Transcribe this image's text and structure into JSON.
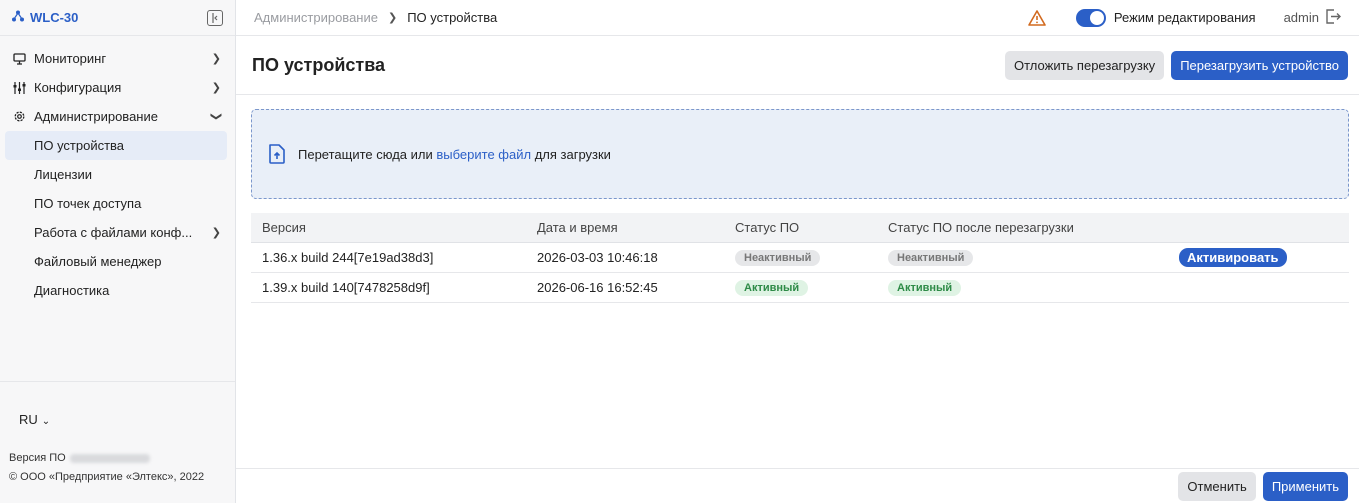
{
  "app": {
    "title": "WLC-30"
  },
  "sidebar": {
    "items": [
      {
        "label": "Мониторинг"
      },
      {
        "label": "Конфигурация"
      },
      {
        "label": "Администрирование"
      }
    ],
    "subitems": [
      {
        "label": "ПО устройства"
      },
      {
        "label": "Лицензии"
      },
      {
        "label": "ПО точек доступа"
      },
      {
        "label": "Работа с файлами конф..."
      },
      {
        "label": "Файловый менеджер"
      },
      {
        "label": "Диагностика"
      }
    ],
    "language": "RU",
    "version_label": "Версия ПО",
    "copyright": "© ООО «Предприятие «Элтекс», 2022"
  },
  "topbar": {
    "breadcrumb_parent": "Администрирование",
    "breadcrumb_current": "ПО устройства",
    "edit_mode_label": "Режим редактирования",
    "username": "admin"
  },
  "page": {
    "title": "ПО устройства",
    "postpone_button": "Отложить перезагрузку",
    "reboot_button": "Перезагрузить устройство"
  },
  "dropzone": {
    "text_before": "Перетащите сюда или ",
    "link": "выберите файл",
    "text_after": " для загрузки"
  },
  "table": {
    "headers": [
      "Версия",
      "Дата и время",
      "Статус ПО",
      "Статус ПО после перезагрузки"
    ],
    "rows": [
      {
        "version": "1.36.x build 244[7e19ad38d3]",
        "datetime": "2026-03-03 10:46:18",
        "status": "Неактивный",
        "status_after": "Неактивный",
        "action": "Активировать"
      },
      {
        "version": "1.39.x build 140[7478258d9f]",
        "datetime": "2026-06-16 16:52:45",
        "status": "Активный",
        "status_after": "Активный"
      }
    ]
  },
  "footer": {
    "cancel_button": "Отменить",
    "apply_button": "Применить"
  },
  "colors": {
    "accent": "#2b5fc7",
    "active_badge": "#2e8b47",
    "warning": "#d26a1f"
  }
}
